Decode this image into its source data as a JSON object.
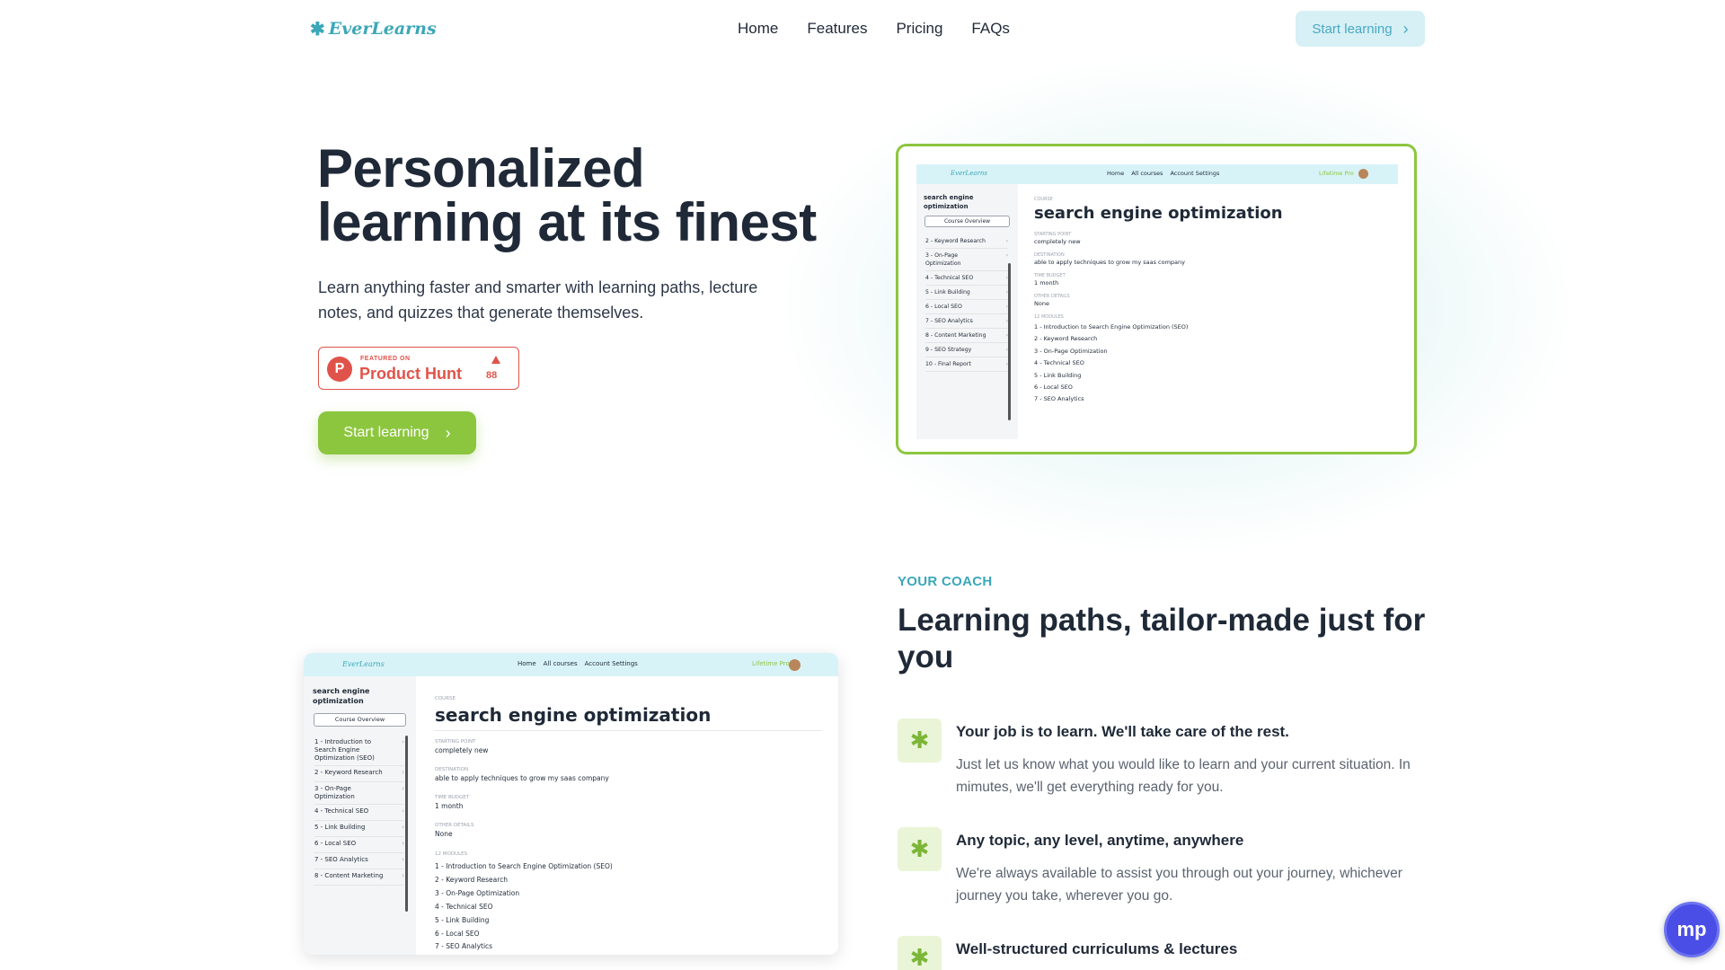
{
  "nav": {
    "logo": "EverLearns",
    "links": [
      "Home",
      "Features",
      "Pricing",
      "FAQs"
    ],
    "cta": "Start learning"
  },
  "hero": {
    "title_line1": "Personalized",
    "title_line2": "learning at its finest",
    "subtitle": "Learn anything faster and smarter with learning paths, lecture notes, and quizzes that generate themselves.",
    "badge": {
      "small": "FEATURED ON",
      "name": "Product Hunt",
      "count": "88",
      "color": "#e0534a"
    },
    "cta": "Start learning"
  },
  "mock": {
    "logo": "EverLearns",
    "nav": [
      "Home",
      "All courses",
      "Account Settings"
    ],
    "user": "Lifetime Pro",
    "sidebar_title": "search engine optimization",
    "overview": "Course Overview",
    "sidebar_items_1": [
      "2 - Keyword Research",
      "3 - On-Page Optimization",
      "4 - Technical SEO",
      "5 - Link Building",
      "6 - Local SEO",
      "7 - SEO Analytics",
      "8 - Content Marketing",
      "9 - SEO Strategy",
      "10 - Final Report"
    ],
    "sidebar_items_2": [
      "1 - Introduction to Search Engine Optimization (SEO)",
      "2 - Keyword Research",
      "3 - On-Page Optimization",
      "4 - Technical SEO",
      "5 - Link Building",
      "6 - Local SEO",
      "7 - SEO Analytics",
      "8 - Content Marketing"
    ],
    "course_label": "COURSE",
    "course_title": "search engine optimization",
    "fields": [
      {
        "label": "STARTING POINT",
        "value": "completely new"
      },
      {
        "label": "DESTINATION",
        "value": "able to apply techniques to grow my saas company"
      },
      {
        "label": "TIME BUDGET",
        "value": "1 month"
      },
      {
        "label": "OTHER DETAILS",
        "value": "None"
      }
    ],
    "modules_label": "12 MODULES",
    "modules": [
      "1 - Introduction to Search Engine Optimization (SEO)",
      "2 - Keyword Research",
      "3 - On-Page Optimization",
      "4 - Technical SEO",
      "5 - Link Building",
      "6 - Local SEO",
      "7 - SEO Analytics"
    ]
  },
  "coach": {
    "kicker": "YOUR COACH",
    "title": "Learning paths, tailor-made just for you",
    "features": [
      {
        "icon": "asterisk-icon",
        "title": "Your job is to learn. We'll take care of the rest.",
        "desc": "Just let us know what you would like to learn and your current situation. In mimutes, we'll get everything ready for you."
      },
      {
        "icon": "asterisk-icon",
        "title": "Any topic, any level, anytime, anywhere",
        "desc": "We're always available to assist you through out your journey, whichever journey you take, wherever you go."
      },
      {
        "icon": "asterisk-icon",
        "title": "Well-structured curriculums & lectures",
        "desc": ""
      }
    ]
  },
  "chat_widget": {
    "label": "mp"
  },
  "colors": {
    "accent_green": "#8cc63f",
    "accent_teal": "#3ba7b8",
    "dark_text": "#1f2937"
  }
}
